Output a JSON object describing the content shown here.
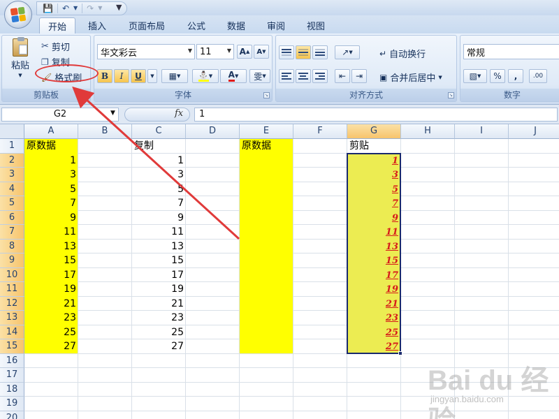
{
  "colors": {
    "highlight": "#ffff00",
    "paste_fill": "#ecec52",
    "selection": "#1a2a6c",
    "annotation": "#e03a3a",
    "paste_text": "#d61b1b"
  },
  "quick_access": {
    "icons": [
      "save-icon",
      "undo-icon",
      "redo-icon",
      "customize-icon"
    ]
  },
  "tabs": [
    {
      "label": "开始",
      "active": true
    },
    {
      "label": "插入"
    },
    {
      "label": "页面布局"
    },
    {
      "label": "公式"
    },
    {
      "label": "数据"
    },
    {
      "label": "审阅"
    },
    {
      "label": "视图"
    }
  ],
  "clipboard": {
    "paste_label": "粘贴",
    "cut_label": "剪切",
    "copy_label": "复制",
    "format_painter_label": "格式刷",
    "group_label": "剪贴板"
  },
  "font": {
    "name": "华文彩云",
    "size": "11",
    "grow_label": "A",
    "shrink_label": "A",
    "bold_label": "B",
    "italic_label": "I",
    "underline_label": "U",
    "font_color_label": "A",
    "phonetic_label": "雯",
    "group_label": "字体"
  },
  "alignment": {
    "wrap_label": "自动换行",
    "merge_label": "合并后居中",
    "group_label": "对齐方式"
  },
  "number": {
    "format": "常规",
    "percent_label": "%",
    "comma_label": ",",
    "increase_decimal_label": ".00",
    "group_label": "数字"
  },
  "formula_bar": {
    "name_box": "G2",
    "fx_label": "fx",
    "content": "1"
  },
  "sheet": {
    "columns": [
      "A",
      "B",
      "C",
      "D",
      "E",
      "F",
      "G",
      "H",
      "I",
      "J"
    ],
    "selected_column": "G",
    "rows": [
      "1",
      "2",
      "3",
      "4",
      "5",
      "6",
      "7",
      "8",
      "9",
      "10",
      "11",
      "12",
      "13",
      "14",
      "15",
      "16",
      "17",
      "18",
      "19",
      "20"
    ],
    "headers": {
      "A": "原数据",
      "C": "复制",
      "E": "原数据",
      "G": "剪贴"
    },
    "col_a": [
      "1",
      "3",
      "5",
      "7",
      "9",
      "11",
      "13",
      "15",
      "17",
      "19",
      "21",
      "23",
      "25",
      "27"
    ],
    "col_c": [
      "1",
      "3",
      "5",
      "7",
      "9",
      "11",
      "13",
      "15",
      "17",
      "19",
      "21",
      "23",
      "25",
      "27"
    ],
    "col_g": [
      "1",
      "3",
      "5",
      "7",
      "9",
      "11",
      "13",
      "15",
      "17",
      "19",
      "21",
      "23",
      "25",
      "27"
    ]
  },
  "watermark": {
    "logo": "Bai du 经验",
    "sub": "jingyan.baidu.com"
  }
}
